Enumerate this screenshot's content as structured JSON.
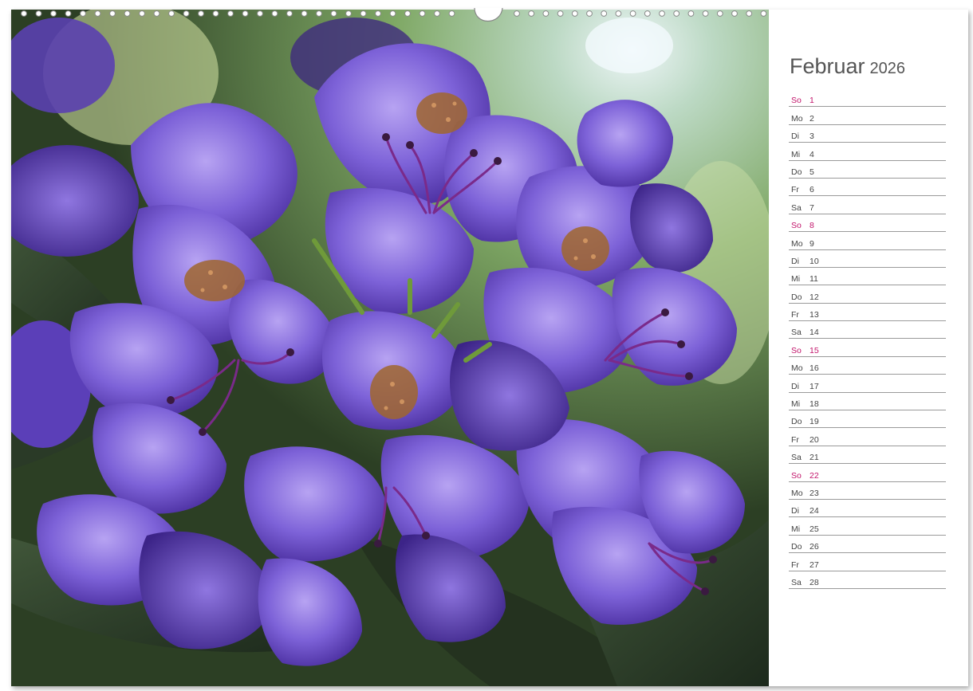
{
  "calendar": {
    "month": "Februar",
    "year": "2026",
    "days": [
      {
        "name": "So",
        "num": "1"
      },
      {
        "name": "Mo",
        "num": "2"
      },
      {
        "name": "Di",
        "num": "3"
      },
      {
        "name": "Mi",
        "num": "4"
      },
      {
        "name": "Do",
        "num": "5"
      },
      {
        "name": "Fr",
        "num": "6"
      },
      {
        "name": "Sa",
        "num": "7"
      },
      {
        "name": "So",
        "num": "8"
      },
      {
        "name": "Mo",
        "num": "9"
      },
      {
        "name": "Di",
        "num": "10"
      },
      {
        "name": "Mi",
        "num": "11"
      },
      {
        "name": "Do",
        "num": "12"
      },
      {
        "name": "Fr",
        "num": "13"
      },
      {
        "name": "Sa",
        "num": "14"
      },
      {
        "name": "So",
        "num": "15"
      },
      {
        "name": "Mo",
        "num": "16"
      },
      {
        "name": "Di",
        "num": "17"
      },
      {
        "name": "Mi",
        "num": "18"
      },
      {
        "name": "Do",
        "num": "19"
      },
      {
        "name": "Fr",
        "num": "20"
      },
      {
        "name": "Sa",
        "num": "21"
      },
      {
        "name": "So",
        "num": "22"
      },
      {
        "name": "Mo",
        "num": "23"
      },
      {
        "name": "Di",
        "num": "24"
      },
      {
        "name": "Mi",
        "num": "25"
      },
      {
        "name": "Do",
        "num": "26"
      },
      {
        "name": "Fr",
        "num": "27"
      },
      {
        "name": "Sa",
        "num": "28"
      }
    ]
  },
  "colors": {
    "sunday": "#c2156b",
    "text": "#444444",
    "rule": "#9a9a9a",
    "petal": "#7a5ed6",
    "leaf": "#2f3f2c"
  }
}
